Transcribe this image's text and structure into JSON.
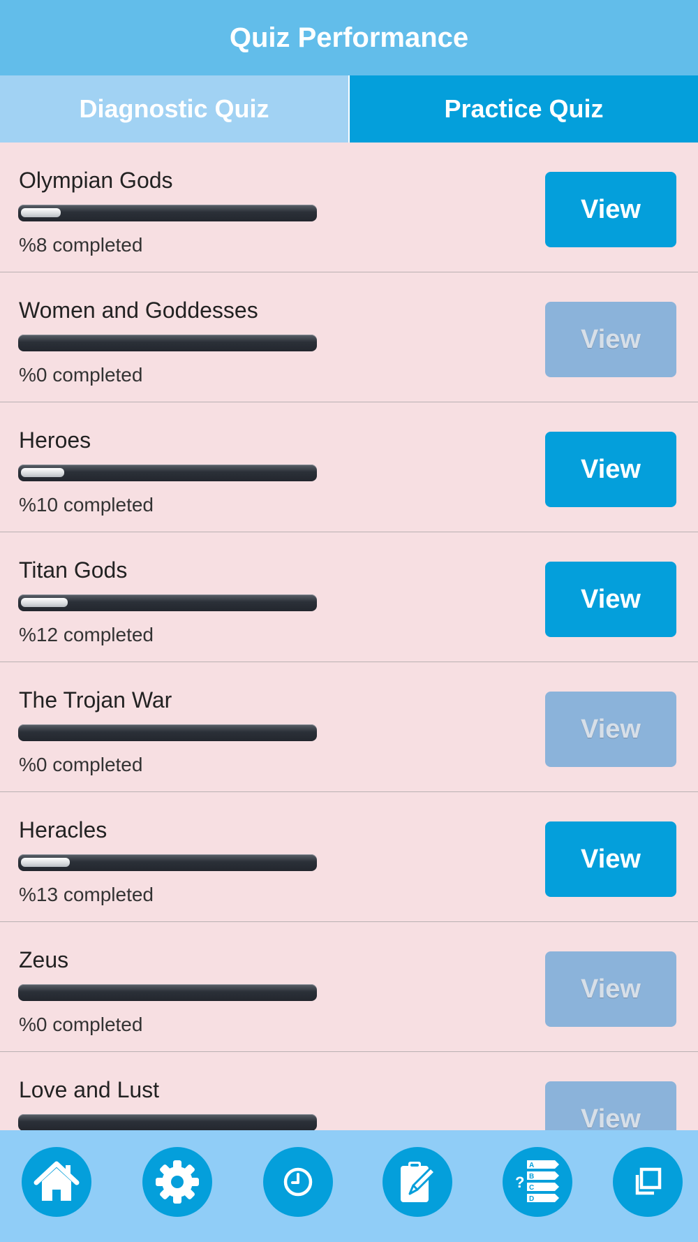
{
  "header": {
    "title": "Quiz Performance"
  },
  "tabs": [
    {
      "label": "Diagnostic Quiz",
      "active": false
    },
    {
      "label": "Practice Quiz",
      "active": true
    }
  ],
  "items": [
    {
      "title": "Olympian Gods",
      "percent_text": "%8 completed",
      "progress": 8,
      "view_label": "View",
      "view_enabled": true
    },
    {
      "title": "Women and Goddesses",
      "percent_text": "%0 completed",
      "progress": 0,
      "view_label": "View",
      "view_enabled": false
    },
    {
      "title": "Heroes",
      "percent_text": "%10 completed",
      "progress": 10,
      "view_label": "View",
      "view_enabled": true
    },
    {
      "title": "Titan Gods",
      "percent_text": "%12 completed",
      "progress": 12,
      "view_label": "View",
      "view_enabled": true
    },
    {
      "title": "The Trojan War",
      "percent_text": "%0 completed",
      "progress": 0,
      "view_label": "View",
      "view_enabled": false
    },
    {
      "title": "Heracles",
      "percent_text": "%13 completed",
      "progress": 13,
      "view_label": "View",
      "view_enabled": true
    },
    {
      "title": "Zeus",
      "percent_text": "%0 completed",
      "progress": 0,
      "view_label": "View",
      "view_enabled": false
    },
    {
      "title": "Love and Lust",
      "percent_text": "",
      "progress": 0,
      "view_label": "View",
      "view_enabled": false
    }
  ],
  "bottom_nav": [
    {
      "icon": "home-icon"
    },
    {
      "icon": "gear-icon"
    },
    {
      "icon": "clock-icon"
    },
    {
      "icon": "clipboard-edit-icon"
    },
    {
      "icon": "quiz-list-icon"
    },
    {
      "icon": "copy-windows-icon"
    }
  ],
  "colors": {
    "header": "#62bdea",
    "tab_active": "#049fdb",
    "tab_inactive": "#a1d2f3",
    "background": "#f7dfe2",
    "button_enabled": "#049fdb",
    "button_disabled": "#8bb3da",
    "bottom_bar": "#90cdf7"
  }
}
